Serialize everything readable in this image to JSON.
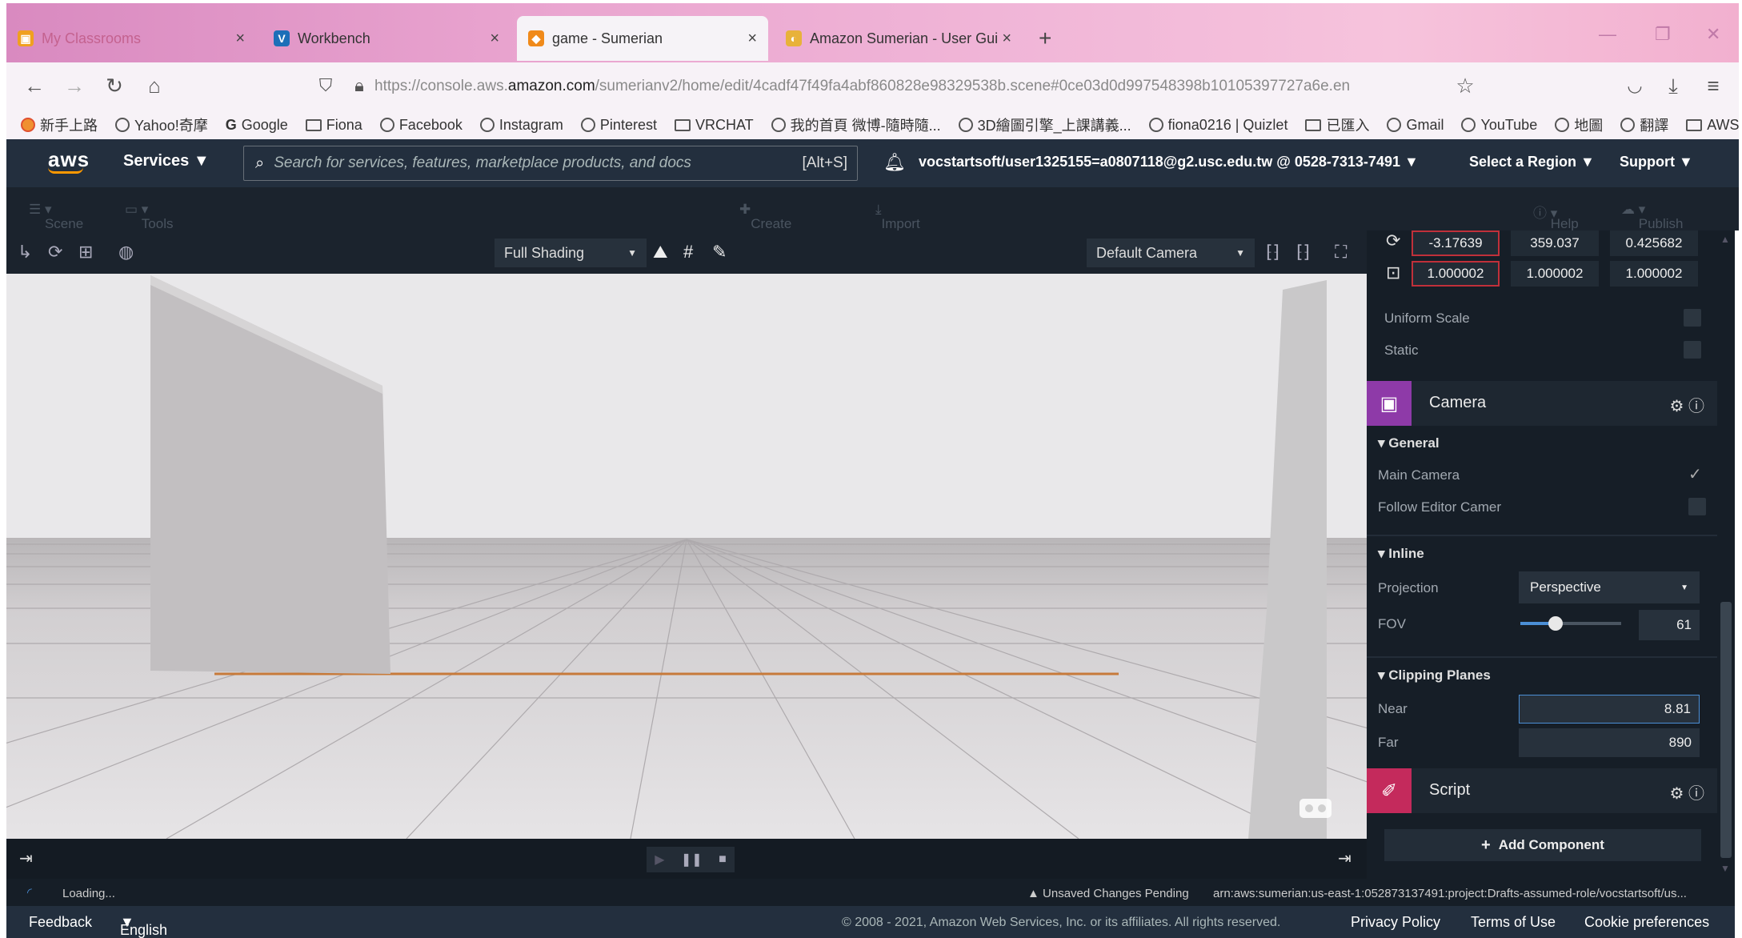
{
  "browser": {
    "tabs": [
      {
        "label": "My Classrooms",
        "icon": "classroom-icon",
        "color": "#f0a020"
      },
      {
        "label": "Workbench",
        "icon": "workbench-icon",
        "color": "#1d6fb8"
      },
      {
        "label": "game - Sumerian",
        "icon": "sumerian-icon",
        "color": "#f08a1a"
      },
      {
        "label": "Amazon Sumerian - User Gui",
        "icon": "docs-icon",
        "color": "#e8b23a"
      }
    ],
    "url_prefix": "https://console.aws.",
    "url_domain": "amazon.com",
    "url_rest": "/sumerianv2/home/edit/4cadf47f49fa4abf860828e98329538b.scene#0ce03d0d997548398b10105397727a6e.en",
    "bookmarks": [
      "新手上路",
      "Yahoo!奇摩",
      "Google",
      "Fiona",
      "Facebook",
      "Instagram",
      "Pinterest",
      "VRCHAT",
      "我的首頁 微博-隨時隨...",
      "3D繪圖引擎_上課講義...",
      "fiona0216 | Quizlet",
      "已匯入",
      "Gmail",
      "YouTube",
      "地圖",
      "翻譯",
      "AWS"
    ]
  },
  "aws": {
    "logo": "aws",
    "services": "Services",
    "search_placeholder": "Search for services, features, marketplace products, and docs",
    "search_shortcut": "[Alt+S]",
    "account": "vocstartsoft/user1325155=a0807118@g2.usc.edu.tw @ 0528-7313-7491",
    "region": "Select a Region",
    "support": "Support"
  },
  "sumerian_toolbar": {
    "scene": "Scene",
    "tools": "Tools",
    "create_entity": "Create Entity",
    "import_assets": "Import Assets",
    "help": "Help",
    "publish": "Publish"
  },
  "viewport_toolbar": {
    "shading": "Full Shading",
    "camera": "Default Camera"
  },
  "panel": {
    "rotation": [
      "-3.17639",
      "359.037",
      "0.425682"
    ],
    "scale": [
      "1.000002",
      "1.000002",
      "1.000002"
    ],
    "uniform_scale": "Uniform Scale",
    "static": "Static",
    "camera_title": "Camera",
    "general": "General",
    "main_camera": "Main Camera",
    "follow_editor": "Follow Editor Camer",
    "inline": "Inline",
    "projection_label": "Projection",
    "projection_value": "Perspective",
    "fov_label": "FOV",
    "fov_value": "61",
    "fov_fraction": 0.35,
    "clipping_planes": "Clipping Planes",
    "near_label": "Near",
    "near_value": "8.81",
    "far_label": "Far",
    "far_value": "890",
    "script_title": "Script",
    "add_component": "Add Component"
  },
  "status": {
    "loading": "Loading...",
    "unsaved": "Unsaved Changes Pending",
    "arn": "arn:aws:sumerian:us-east-1:052873137491:project:Drafts-assumed-role/vocstartsoft/us..."
  },
  "footer": {
    "feedback": "Feedback",
    "language": "English (US)",
    "copyright": "© 2008 - 2021, Amazon Web Services, Inc. or its affiliates. All rights reserved.",
    "privacy": "Privacy Policy",
    "terms": "Terms of Use",
    "cookie": "Cookie preferences"
  }
}
